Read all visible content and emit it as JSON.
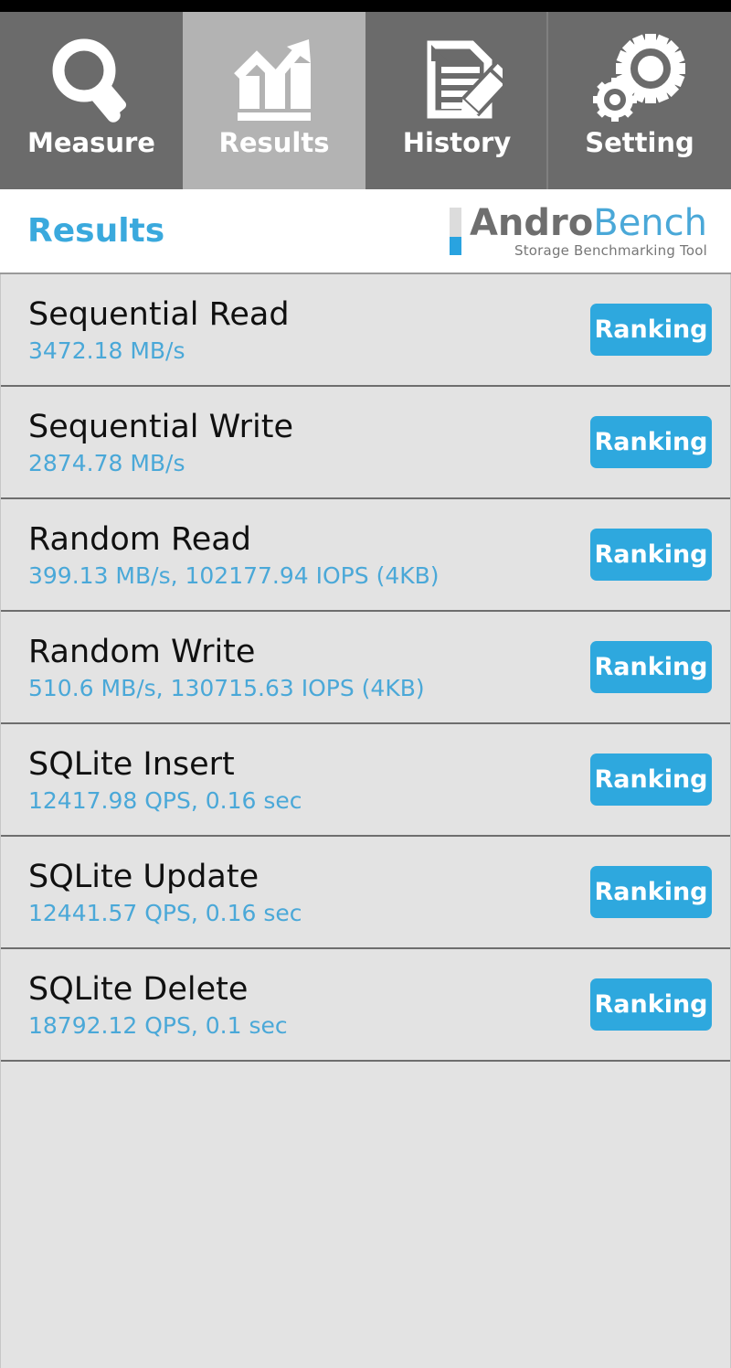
{
  "app": {
    "name": "AndroBench",
    "brand_first": "Andro",
    "brand_second": "Bench",
    "tagline": "Storage Benchmarking Tool"
  },
  "tabs": [
    {
      "label": "Measure",
      "icon": "magnifier-icon",
      "active": false
    },
    {
      "label": "Results",
      "icon": "bar-chart-arrow-icon",
      "active": true
    },
    {
      "label": "History",
      "icon": "document-pencil-icon",
      "active": false
    },
    {
      "label": "Setting",
      "icon": "gears-icon",
      "active": false
    }
  ],
  "header": {
    "title": "Results"
  },
  "results": {
    "ranking_label": "Ranking",
    "rows": [
      {
        "title": "Sequential Read",
        "value": "3472.18 MB/s"
      },
      {
        "title": "Sequential Write",
        "value": "2874.78 MB/s"
      },
      {
        "title": "Random Read",
        "value": "399.13 MB/s, 102177.94 IOPS (4KB)"
      },
      {
        "title": "Random Write",
        "value": "510.6 MB/s, 130715.63 IOPS (4KB)"
      },
      {
        "title": "SQLite Insert",
        "value": "12417.98 QPS, 0.16 sec"
      },
      {
        "title": "SQLite Update",
        "value": "12441.57 QPS, 0.16 sec"
      },
      {
        "title": "SQLite Delete",
        "value": "18792.12 QPS, 0.1 sec"
      }
    ]
  },
  "colors": {
    "accent_blue": "#2ea8de",
    "value_blue": "#4aa8d8",
    "title_blue": "#3aa9dd",
    "tab_inactive": "#6b6b6b",
    "tab_active": "#b3b3b3",
    "row_bg": "#e3e3e3",
    "row_separator": "#6e6e6e",
    "brand_gray": "#6e6e6e"
  }
}
